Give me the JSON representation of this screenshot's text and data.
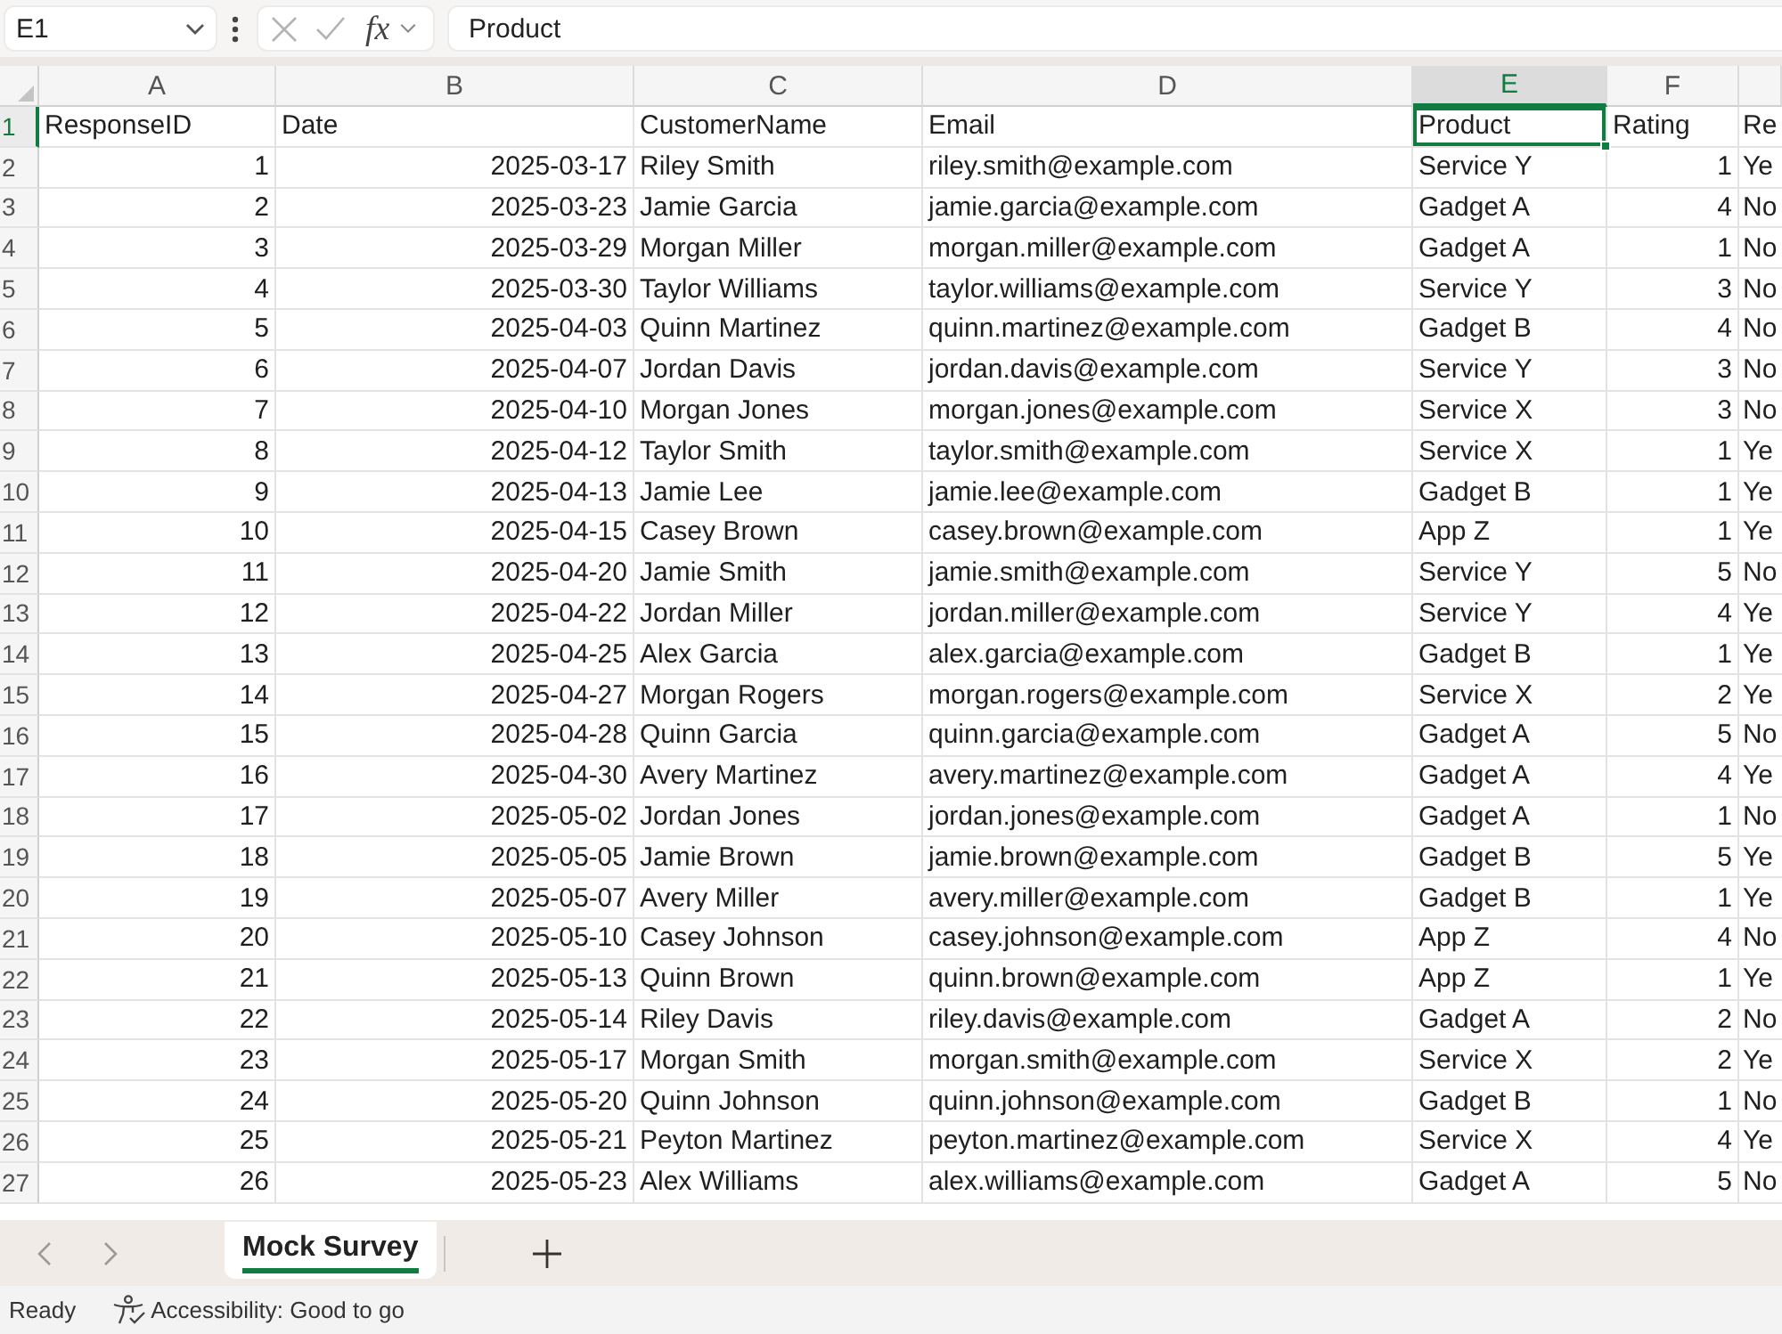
{
  "name_box": {
    "value": "E1"
  },
  "formula_bar": {
    "function_label": "fx",
    "value": "Product"
  },
  "grid": {
    "columns": [
      {
        "letter": "A",
        "kind": "number",
        "selected": false
      },
      {
        "letter": "B",
        "kind": "number",
        "selected": false
      },
      {
        "letter": "C",
        "kind": "text",
        "selected": false
      },
      {
        "letter": "D",
        "kind": "text",
        "selected": false
      },
      {
        "letter": "E",
        "kind": "text",
        "selected": true
      },
      {
        "letter": "F",
        "kind": "number",
        "selected": false
      },
      {
        "kind": "text",
        "selected": false
      }
    ],
    "rows": [
      {
        "number": "1",
        "kind": "header",
        "selected": true,
        "cells": [
          "ResponseID",
          "Date",
          "CustomerName",
          "Email",
          "Product",
          "Rating",
          "Re"
        ]
      },
      {
        "number": "2",
        "kind": "data",
        "selected": false,
        "cells": [
          "1",
          "2025-03-17",
          "Riley Smith",
          "riley.smith@example.com",
          "Service Y",
          "1",
          "Ye"
        ]
      },
      {
        "number": "3",
        "kind": "data",
        "selected": false,
        "cells": [
          "2",
          "2025-03-23",
          "Jamie Garcia",
          "jamie.garcia@example.com",
          "Gadget A",
          "4",
          "No"
        ]
      },
      {
        "number": "4",
        "kind": "data",
        "selected": false,
        "cells": [
          "3",
          "2025-03-29",
          "Morgan Miller",
          "morgan.miller@example.com",
          "Gadget A",
          "1",
          "No"
        ]
      },
      {
        "number": "5",
        "kind": "data",
        "selected": false,
        "cells": [
          "4",
          "2025-03-30",
          "Taylor Williams",
          "taylor.williams@example.com",
          "Service Y",
          "3",
          "No"
        ]
      },
      {
        "number": "6",
        "kind": "data",
        "selected": false,
        "cells": [
          "5",
          "2025-04-03",
          "Quinn Martinez",
          "quinn.martinez@example.com",
          "Gadget B",
          "4",
          "No"
        ]
      },
      {
        "number": "7",
        "kind": "data",
        "selected": false,
        "cells": [
          "6",
          "2025-04-07",
          "Jordan Davis",
          "jordan.davis@example.com",
          "Service Y",
          "3",
          "No"
        ]
      },
      {
        "number": "8",
        "kind": "data",
        "selected": false,
        "cells": [
          "7",
          "2025-04-10",
          "Morgan Jones",
          "morgan.jones@example.com",
          "Service X",
          "3",
          "No"
        ]
      },
      {
        "number": "9",
        "kind": "data",
        "selected": false,
        "cells": [
          "8",
          "2025-04-12",
          "Taylor Smith",
          "taylor.smith@example.com",
          "Service X",
          "1",
          "Ye"
        ]
      },
      {
        "number": "10",
        "kind": "data",
        "selected": false,
        "cells": [
          "9",
          "2025-04-13",
          "Jamie Lee",
          "jamie.lee@example.com",
          "Gadget B",
          "1",
          "Ye"
        ]
      },
      {
        "number": "11",
        "kind": "data",
        "selected": false,
        "cells": [
          "10",
          "2025-04-15",
          "Casey Brown",
          "casey.brown@example.com",
          "App Z",
          "1",
          "Ye"
        ]
      },
      {
        "number": "12",
        "kind": "data",
        "selected": false,
        "cells": [
          "11",
          "2025-04-20",
          "Jamie Smith",
          "jamie.smith@example.com",
          "Service Y",
          "5",
          "No"
        ]
      },
      {
        "number": "13",
        "kind": "data",
        "selected": false,
        "cells": [
          "12",
          "2025-04-22",
          "Jordan Miller",
          "jordan.miller@example.com",
          "Service Y",
          "4",
          "Ye"
        ]
      },
      {
        "number": "14",
        "kind": "data",
        "selected": false,
        "cells": [
          "13",
          "2025-04-25",
          "Alex Garcia",
          "alex.garcia@example.com",
          "Gadget B",
          "1",
          "Ye"
        ]
      },
      {
        "number": "15",
        "kind": "data",
        "selected": false,
        "cells": [
          "14",
          "2025-04-27",
          "Morgan Rogers",
          "morgan.rogers@example.com",
          "Service X",
          "2",
          "Ye"
        ]
      },
      {
        "number": "16",
        "kind": "data",
        "selected": false,
        "cells": [
          "15",
          "2025-04-28",
          "Quinn Garcia",
          "quinn.garcia@example.com",
          "Gadget A",
          "5",
          "No"
        ]
      },
      {
        "number": "17",
        "kind": "data",
        "selected": false,
        "cells": [
          "16",
          "2025-04-30",
          "Avery Martinez",
          "avery.martinez@example.com",
          "Gadget A",
          "4",
          "Ye"
        ]
      },
      {
        "number": "18",
        "kind": "data",
        "selected": false,
        "cells": [
          "17",
          "2025-05-02",
          "Jordan Jones",
          "jordan.jones@example.com",
          "Gadget A",
          "1",
          "No"
        ]
      },
      {
        "number": "19",
        "kind": "data",
        "selected": false,
        "cells": [
          "18",
          "2025-05-05",
          "Jamie Brown",
          "jamie.brown@example.com",
          "Gadget B",
          "5",
          "Ye"
        ]
      },
      {
        "number": "20",
        "kind": "data",
        "selected": false,
        "cells": [
          "19",
          "2025-05-07",
          "Avery Miller",
          "avery.miller@example.com",
          "Gadget B",
          "1",
          "Ye"
        ]
      },
      {
        "number": "21",
        "kind": "data",
        "selected": false,
        "cells": [
          "20",
          "2025-05-10",
          "Casey Johnson",
          "casey.johnson@example.com",
          "App Z",
          "4",
          "No"
        ]
      },
      {
        "number": "22",
        "kind": "data",
        "selected": false,
        "cells": [
          "21",
          "2025-05-13",
          "Quinn Brown",
          "quinn.brown@example.com",
          "App Z",
          "1",
          "Ye"
        ]
      },
      {
        "number": "23",
        "kind": "data",
        "selected": false,
        "cells": [
          "22",
          "2025-05-14",
          "Riley Davis",
          "riley.davis@example.com",
          "Gadget A",
          "2",
          "No"
        ]
      },
      {
        "number": "24",
        "kind": "data",
        "selected": false,
        "cells": [
          "23",
          "2025-05-17",
          "Morgan Smith",
          "morgan.smith@example.com",
          "Service X",
          "2",
          "Ye"
        ]
      },
      {
        "number": "25",
        "kind": "data",
        "selected": false,
        "cells": [
          "24",
          "2025-05-20",
          "Quinn Johnson",
          "quinn.johnson@example.com",
          "Gadget B",
          "1",
          "No"
        ]
      },
      {
        "number": "26",
        "kind": "data",
        "selected": false,
        "cells": [
          "25",
          "2025-05-21",
          "Peyton Martinez",
          "peyton.martinez@example.com",
          "Service X",
          "4",
          "Ye"
        ]
      },
      {
        "number": "27",
        "kind": "data",
        "selected": false,
        "cells": [
          "26",
          "2025-05-23",
          "Alex Williams",
          "alex.williams@example.com",
          "Gadget A",
          "5",
          "No"
        ]
      }
    ]
  },
  "sheets": [
    {
      "label": "Mock Survey",
      "selected": true
    }
  ],
  "status_bar": {
    "mode": "Ready",
    "accessibility": "Accessibility: Good to go"
  }
}
